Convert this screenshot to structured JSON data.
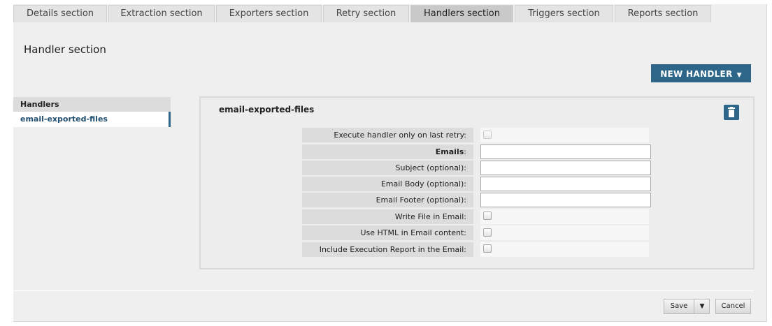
{
  "tabs": [
    {
      "label": "Details section",
      "active": false
    },
    {
      "label": "Extraction section",
      "active": false
    },
    {
      "label": "Exporters section",
      "active": false
    },
    {
      "label": "Retry section",
      "active": false
    },
    {
      "label": "Handlers section",
      "active": true
    },
    {
      "label": "Triggers section",
      "active": false
    },
    {
      "label": "Reports section",
      "active": false
    }
  ],
  "page": {
    "title": "Handler section"
  },
  "toolbar": {
    "new_handler_label": "NEW HANDLER",
    "new_handler_caret": "▼"
  },
  "sidebar": {
    "header": "Handlers",
    "items": [
      {
        "label": "email-exported-files",
        "selected": true
      }
    ]
  },
  "handler": {
    "title": "email-exported-files",
    "delete_icon": "trash-icon",
    "fields": {
      "last_retry_only": {
        "label": "Execute handler only on last retry:",
        "checked": false,
        "disabled": true
      },
      "emails": {
        "label": "Emails",
        "label_suffix": ":",
        "value": ""
      },
      "subject": {
        "label": "Subject (optional):",
        "value": ""
      },
      "body": {
        "label": "Email Body (optional):",
        "value": ""
      },
      "footer": {
        "label": "Email Footer (optional):",
        "value": ""
      },
      "write_file": {
        "label": "Write File in Email:",
        "checked": false
      },
      "use_html": {
        "label": "Use HTML in Email content:",
        "checked": false
      },
      "include_report": {
        "label": "Include Execution Report in the Email:",
        "checked": false
      }
    }
  },
  "footer": {
    "save_label": "Save",
    "save_caret": "▼",
    "cancel_label": "Cancel"
  },
  "colors": {
    "accent": "#2e6689",
    "background": "#efefef"
  }
}
